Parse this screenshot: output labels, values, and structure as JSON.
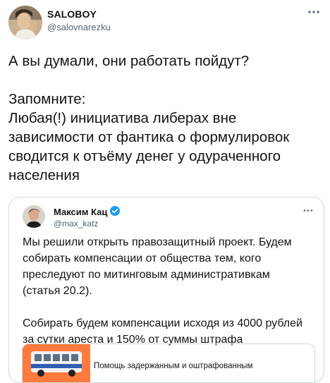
{
  "tweet": {
    "author_name": "SALOBOY",
    "author_handle": "@salovnarezku",
    "more_icon": "more-dots-icon",
    "text": "А вы думали, они работать пойдут?\n\nЗапомните:\nЛюбая(!) инициатива либерах вне\nзависимости от фантика о формулировок\nсводится к отъёму денег у одураченного\nнаселения"
  },
  "quoted": {
    "author_name": "Максим Кац",
    "author_handle": "@max_katz",
    "verified_icon": "verified-badge-icon",
    "verified_color": "#1d9bf0",
    "text": "Мы решили открыть правозащитный проект. Будем\nсобирать компенсации от общества тем, кого\nпреследуют по митинговым административкам\n(статья 20.2).\n\nСобирать будем компенсации исходя из 4000 рублей\nза сутки ареста и 150% от суммы штрафа",
    "card": {
      "title": "Помощь задержанным и оштрафованным",
      "accent_color": "#ff7a3d"
    }
  }
}
